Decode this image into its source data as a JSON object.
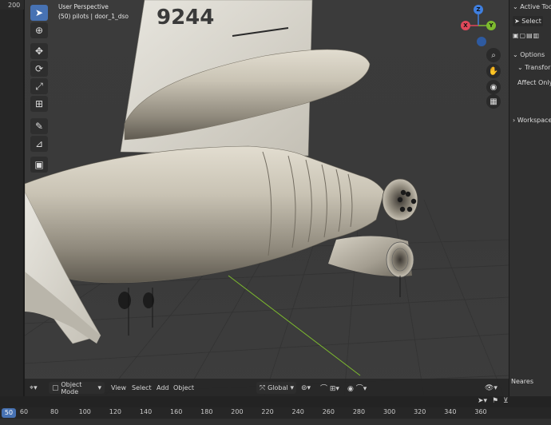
{
  "left_strip": {
    "frame_number": "200"
  },
  "viewport": {
    "perspective_label": "User Perspective",
    "object_info": "(50) pilots | door_1_dso",
    "tail_number": "9244"
  },
  "gizmo": {
    "z": "Z",
    "x": "X",
    "y": "Y"
  },
  "header": {
    "mode": "Object Mode",
    "menus": [
      "View",
      "Select",
      "Add",
      "Object"
    ],
    "orientation": "Global"
  },
  "properties": {
    "active_tool": "Active Tool",
    "select": "Select",
    "options": "Options",
    "transform": "Transform",
    "affect_only": "Affect Only",
    "workspace": "Workspace",
    "nearest": "Neares"
  },
  "timeline": {
    "current_frame": "50",
    "ticks": [
      "60",
      "80",
      "100",
      "120",
      "140",
      "160",
      "180",
      "200",
      "220",
      "240",
      "260",
      "280",
      "300",
      "320",
      "340",
      "360"
    ]
  },
  "colors": {
    "accent": "#4772b3",
    "axis_x": "#e0485a",
    "axis_y": "#7dbb2e",
    "axis_z": "#3f7fe0"
  }
}
